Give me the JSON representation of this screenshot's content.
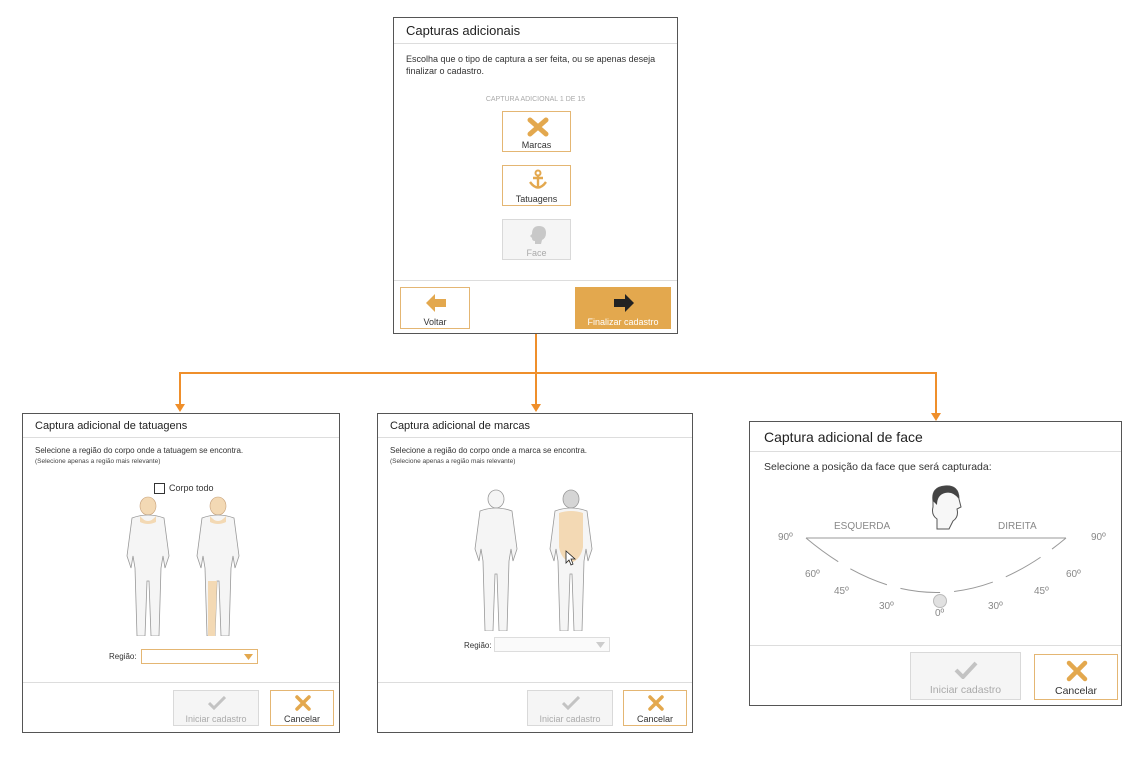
{
  "top": {
    "title": "Capturas adicionais",
    "desc": "Escolha que o tipo de captura a ser feita, ou se apenas deseja finalizar o cadastro.",
    "counter": "CAPTURA ADICIONAL 1 DE 15",
    "options": [
      {
        "label": "Marcas",
        "icon": "x-marks-icon"
      },
      {
        "label": "Tatuagens",
        "icon": "anchor-icon"
      },
      {
        "label": "Face",
        "icon": "head-icon"
      }
    ],
    "back_label": "Voltar",
    "finish_label": "Finalizar cadastro"
  },
  "tattoo": {
    "title": "Captura adicional de tatuagens",
    "desc": "Selecione a região do corpo onde a tatuagem se encontra.",
    "hint": "(Selecione apenas a região mais relevante)",
    "whole_body_label": "Corpo todo",
    "region_label": "Região:",
    "region_value": "",
    "start_label": "Iniciar cadastro",
    "cancel_label": "Cancelar"
  },
  "marks": {
    "title": "Captura adicional de marcas",
    "desc": "Selecione a região do corpo onde a marca se encontra.",
    "hint": "(Selecione apenas a região mais relevante)",
    "region_label": "Região:",
    "region_value": "",
    "start_label": "Iniciar cadastro",
    "cancel_label": "Cancelar"
  },
  "face": {
    "title": "Captura adicional de face",
    "desc": "Selecione a posição da face que será capturada:",
    "left_label": "ESQUERDA",
    "right_label": "DIREITA",
    "angles": {
      "l90": "90º",
      "l60": "60º",
      "l45": "45º",
      "l30": "30º",
      "c0": "0º",
      "r30": "30º",
      "r45": "45º",
      "r60": "60º",
      "r90": "90º"
    },
    "start_label": "Iniciar cadastro",
    "cancel_label": "Cancelar"
  },
  "colors": {
    "accent": "#e3a84e",
    "connector": "#ef8f2b",
    "highlight": "#f3d9b4"
  }
}
